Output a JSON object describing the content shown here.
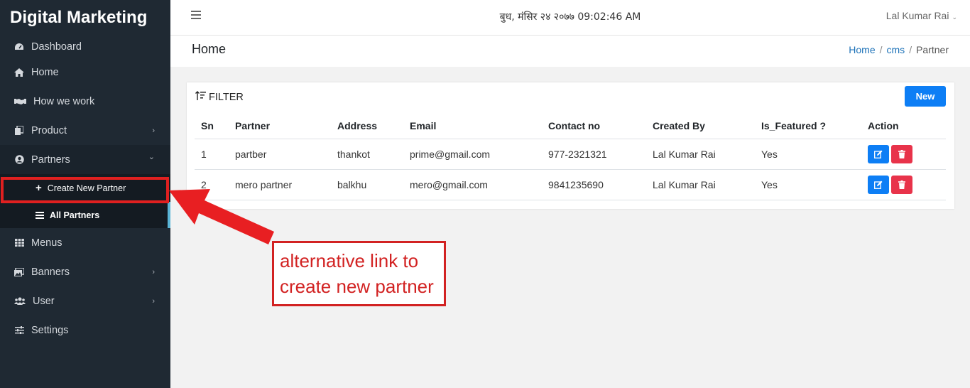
{
  "sidebar": {
    "brand": "Digital Marketing",
    "items": [
      {
        "label": "Dashboard",
        "icon": "dashboard-icon"
      },
      {
        "label": "Home",
        "icon": "home-icon"
      },
      {
        "label": "How we work",
        "icon": "handshake-icon"
      },
      {
        "label": "Product",
        "icon": "copy-icon",
        "chevron": "›"
      },
      {
        "label": "Partners",
        "icon": "user-circle-icon",
        "chevron": "⌄"
      },
      {
        "label": "Menus",
        "icon": "grid-icon"
      },
      {
        "label": "Banners",
        "icon": "images-icon",
        "chevron": "›"
      },
      {
        "label": "User",
        "icon": "users-icon",
        "chevron": "›"
      },
      {
        "label": "Settings",
        "icon": "sliders-icon"
      }
    ],
    "partners_sub": [
      {
        "label": "Create New Partner",
        "icon": "plus-icon"
      },
      {
        "label": "All Partners",
        "icon": "list-icon"
      }
    ]
  },
  "topbar": {
    "datetime": "बुध, मंसिर २४ २०७७ 09:02:46 AM",
    "user": "Lal Kumar Rai"
  },
  "page": {
    "title": "Home",
    "breadcrumb": [
      "Home",
      "cms",
      "Partner"
    ]
  },
  "card": {
    "filter_label": "FILTER",
    "new_button": "New",
    "columns": [
      "Sn",
      "Partner",
      "Address",
      "Email",
      "Contact no",
      "Created By",
      "Is_Featured ?",
      "Action"
    ],
    "rows": [
      [
        "1",
        "partber",
        "thankot",
        "prime@gmail.com",
        "977-2321321",
        "Lal Kumar Rai",
        "Yes"
      ],
      [
        "2",
        "mero partner",
        "balkhu",
        "mero@gmail.com",
        "9841235690",
        "Lal Kumar Rai",
        "Yes"
      ]
    ]
  },
  "annotation": {
    "line1": "alternative link to",
    "line2": "create new partner",
    "color": "#d22222"
  }
}
